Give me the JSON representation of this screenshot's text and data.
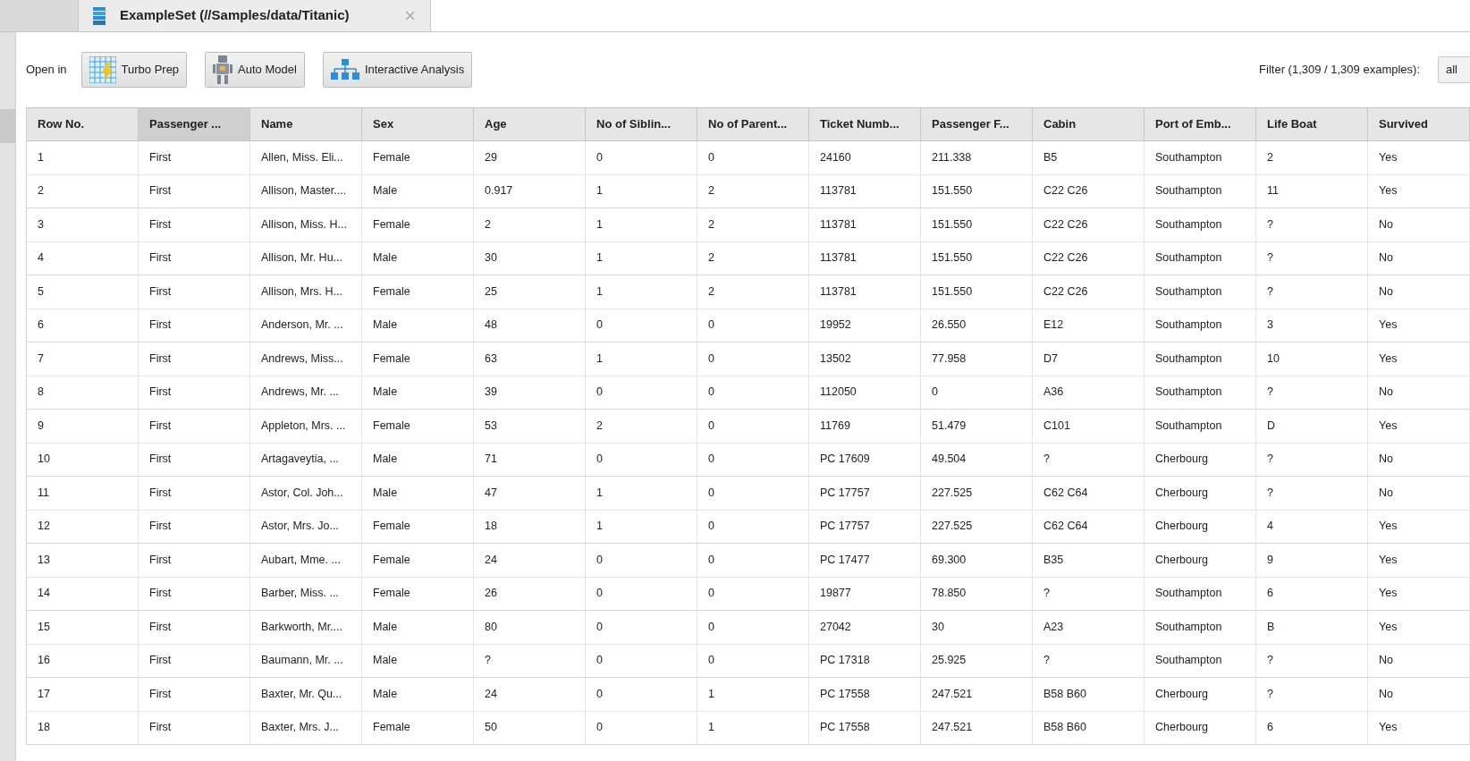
{
  "tab": {
    "title": "ExampleSet (//Samples/data/Titanic)",
    "close": "×"
  },
  "toolbar": {
    "label": "Open in",
    "buttons": [
      {
        "kind": "grid",
        "label": "Turbo Prep"
      },
      {
        "kind": "robot",
        "label": "Auto Model"
      },
      {
        "kind": "hierarchy",
        "label": "Interactive Analysis"
      }
    ],
    "filter_label": "Filter (1,309 / 1,309 examples):",
    "filter_value": "all"
  },
  "table": {
    "columns": [
      {
        "label": "Row No.",
        "selected": false
      },
      {
        "label": "Passenger ...",
        "selected": true
      },
      {
        "label": "Name",
        "selected": false
      },
      {
        "label": "Sex",
        "selected": false
      },
      {
        "label": "Age",
        "selected": false
      },
      {
        "label": "No of Siblin...",
        "selected": false
      },
      {
        "label": "No of Parent...",
        "selected": false
      },
      {
        "label": "Ticket Numb...",
        "selected": false
      },
      {
        "label": "Passenger F...",
        "selected": false
      },
      {
        "label": "Cabin",
        "selected": false
      },
      {
        "label": "Port of Emb...",
        "selected": false
      },
      {
        "label": "Life Boat",
        "selected": false
      },
      {
        "label": "Survived",
        "selected": false
      }
    ],
    "rows": [
      [
        "1",
        "First",
        "Allen, Miss. Eli...",
        "Female",
        "29",
        "0",
        "0",
        "24160",
        "211.338",
        "B5",
        "Southampton",
        "2",
        "Yes"
      ],
      [
        "2",
        "First",
        "Allison, Master....",
        "Male",
        "0.917",
        "1",
        "2",
        "113781",
        "151.550",
        "C22 C26",
        "Southampton",
        "11",
        "Yes"
      ],
      [
        "3",
        "First",
        "Allison, Miss. H...",
        "Female",
        "2",
        "1",
        "2",
        "113781",
        "151.550",
        "C22 C26",
        "Southampton",
        "?",
        "No"
      ],
      [
        "4",
        "First",
        "Allison, Mr. Hu...",
        "Male",
        "30",
        "1",
        "2",
        "113781",
        "151.550",
        "C22 C26",
        "Southampton",
        "?",
        "No"
      ],
      [
        "5",
        "First",
        "Allison, Mrs. H...",
        "Female",
        "25",
        "1",
        "2",
        "113781",
        "151.550",
        "C22 C26",
        "Southampton",
        "?",
        "No"
      ],
      [
        "6",
        "First",
        "Anderson, Mr. ...",
        "Male",
        "48",
        "0",
        "0",
        "19952",
        "26.550",
        "E12",
        "Southampton",
        "3",
        "Yes"
      ],
      [
        "7",
        "First",
        "Andrews, Miss...",
        "Female",
        "63",
        "1",
        "0",
        "13502",
        "77.958",
        "D7",
        "Southampton",
        "10",
        "Yes"
      ],
      [
        "8",
        "First",
        "Andrews, Mr. ...",
        "Male",
        "39",
        "0",
        "0",
        "112050",
        "0",
        "A36",
        "Southampton",
        "?",
        "No"
      ],
      [
        "9",
        "First",
        "Appleton, Mrs. ...",
        "Female",
        "53",
        "2",
        "0",
        "11769",
        "51.479",
        "C101",
        "Southampton",
        "D",
        "Yes"
      ],
      [
        "10",
        "First",
        "Artagaveytia, ...",
        "Male",
        "71",
        "0",
        "0",
        "PC 17609",
        "49.504",
        "?",
        "Cherbourg",
        "?",
        "No"
      ],
      [
        "11",
        "First",
        "Astor, Col. Joh...",
        "Male",
        "47",
        "1",
        "0",
        "PC 17757",
        "227.525",
        "C62 C64",
        "Cherbourg",
        "?",
        "No"
      ],
      [
        "12",
        "First",
        "Astor, Mrs. Jo...",
        "Female",
        "18",
        "1",
        "0",
        "PC 17757",
        "227.525",
        "C62 C64",
        "Cherbourg",
        "4",
        "Yes"
      ],
      [
        "13",
        "First",
        "Aubart, Mme. ...",
        "Female",
        "24",
        "0",
        "0",
        "PC 17477",
        "69.300",
        "B35",
        "Cherbourg",
        "9",
        "Yes"
      ],
      [
        "14",
        "First",
        "Barber, Miss. ...",
        "Female",
        "26",
        "0",
        "0",
        "19877",
        "78.850",
        "?",
        "Southampton",
        "6",
        "Yes"
      ],
      [
        "15",
        "First",
        "Barkworth, Mr....",
        "Male",
        "80",
        "0",
        "0",
        "27042",
        "30",
        "A23",
        "Southampton",
        "B",
        "Yes"
      ],
      [
        "16",
        "First",
        "Baumann, Mr. ...",
        "Male",
        "?",
        "0",
        "0",
        "PC 17318",
        "25.925",
        "?",
        "Southampton",
        "?",
        "No"
      ],
      [
        "17",
        "First",
        "Baxter, Mr. Qu...",
        "Male",
        "24",
        "0",
        "1",
        "PC 17558",
        "247.521",
        "B58 B60",
        "Cherbourg",
        "?",
        "No"
      ],
      [
        "18",
        "First",
        "Baxter, Mrs. J...",
        "Female",
        "50",
        "0",
        "1",
        "PC 17558",
        "247.521",
        "B58 B60",
        "Cherbourg",
        "6",
        "Yes"
      ]
    ]
  }
}
